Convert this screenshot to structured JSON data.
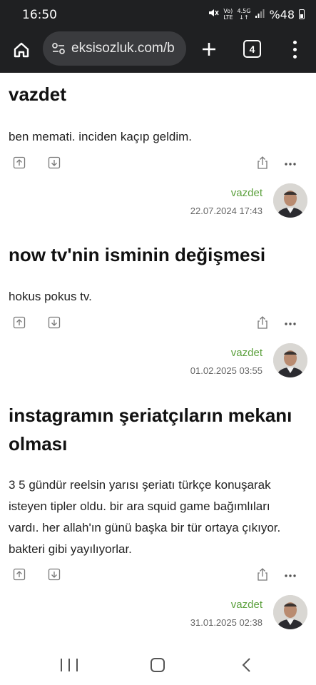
{
  "status_bar": {
    "time": "16:50",
    "network_top": "Vo)",
    "network_bottom": "LTE",
    "network_gen_top": "4.5G",
    "network_gen_bottom": "↓↑",
    "battery": "%48",
    "icons": [
      "mute-icon",
      "signal-icon",
      "battery-icon"
    ]
  },
  "browser": {
    "url": "eksisozluk.com/b",
    "tab_count": "4",
    "icons": [
      "home-icon",
      "site-settings-icon",
      "plus-icon",
      "tabs-icon",
      "menu-icon"
    ]
  },
  "entries": [
    {
      "title": "vazdet",
      "body": "ben memati. inciden kaçıp geldim.",
      "author": "vazdet",
      "date": "22.07.2024 17:43"
    },
    {
      "title": "now tv'nin isminin değişmesi",
      "body": "hokus pokus tv.",
      "author": "vazdet",
      "date": "01.02.2025 03:55"
    },
    {
      "title_line1": "instagramın şeriatçıların mekanı",
      "title_line2": "olması",
      "body_lines": [
        "3 5 gündür reelsin yarısı şeriatı türkçe konuşarak",
        "isteyen tipler oldu. bir ara squid game bağımlıları",
        "vardı. her allah'ın günü başka bir tür ortaya çıkıyor.",
        "bakteri gibi yayılıyorlar."
      ],
      "author": "vazdet",
      "date": "31.01.2025 02:38"
    }
  ],
  "entry_icons": [
    "upvote-icon",
    "downvote-icon",
    "share-icon",
    "more-icon"
  ],
  "nav": [
    "recent-apps-icon",
    "home-icon",
    "back-icon"
  ]
}
